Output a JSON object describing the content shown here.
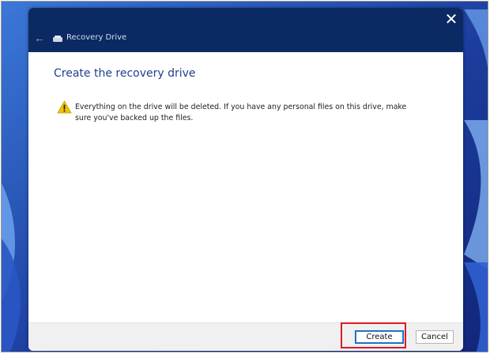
{
  "window": {
    "title": "Recovery Drive",
    "close_glyph": "✕",
    "back_glyph": "←"
  },
  "content": {
    "heading": "Create the recovery drive",
    "warning_text": "Everything on the drive will be deleted. If you have any personal files on this drive, make sure you've backed up the files."
  },
  "footer": {
    "create_label": "Create",
    "cancel_label": "Cancel"
  },
  "colors": {
    "titlebar": "#0b2a63",
    "heading": "#1f3e8f",
    "highlight": "#d91e23",
    "warning": "#f2c200"
  },
  "icons": [
    "close-icon",
    "back-arrow-icon",
    "drive-icon",
    "warning-icon"
  ]
}
